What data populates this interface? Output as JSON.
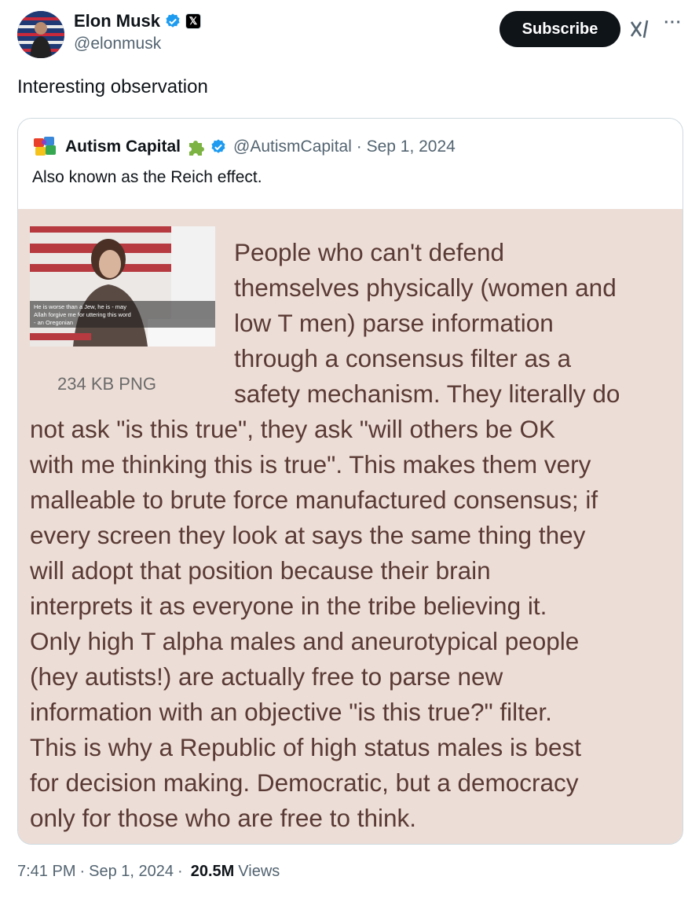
{
  "author": {
    "name": "Elon Musk",
    "handle": "@elonmusk"
  },
  "actions": {
    "subscribe_label": "Subscribe",
    "more_label": "···"
  },
  "tweet": {
    "text": "Interesting observation"
  },
  "quote": {
    "author_name": "Autism Capital",
    "handle": "@AutismCapital",
    "date": "Sep 1, 2024",
    "text": "Also known as the Reich effect.",
    "image_file_size": "234 KB PNG",
    "image_caption_lines": [
      "He is worse than a Jew, he is - may",
      "Allah forgive me for uttering this word",
      "- an Oregonian"
    ],
    "image_lines": [
      "People who can't defend",
      "themselves physically (women and",
      "low T men) parse information",
      "through a consensus filter as a",
      "safety mechanism. They literally do",
      "not ask \"is this true\", they ask \"will others be OK",
      "with me thinking this is true\". This makes them very",
      "malleable to brute force manufactured consensus; if",
      "every screen they look at says the same thing they",
      "will adopt that position because their brain",
      "interprets it as everyone in the tribe believing it.",
      "Only high T alpha males and aneurotypical people",
      "(hey autists!) are actually free to parse new",
      "information with an objective \"is this true?\" filter.",
      "This is why a Republic of high status males is best",
      "for decision making. Democratic, but a democracy",
      "only for those who are free to think."
    ]
  },
  "footer": {
    "time": "7:41 PM",
    "date": "Sep 1, 2024",
    "views_count": "20.5M",
    "views_label": "Views"
  },
  "colors": {
    "image_background": "#ecddd6",
    "image_text": "#5a3a34",
    "verified_blue": "#1d9bf0",
    "subscribe_bg": "#0f1419"
  },
  "icons": [
    "verified-badge-icon",
    "x-logo-icon",
    "grok-icon",
    "more-icon",
    "puzzle-icon"
  ]
}
